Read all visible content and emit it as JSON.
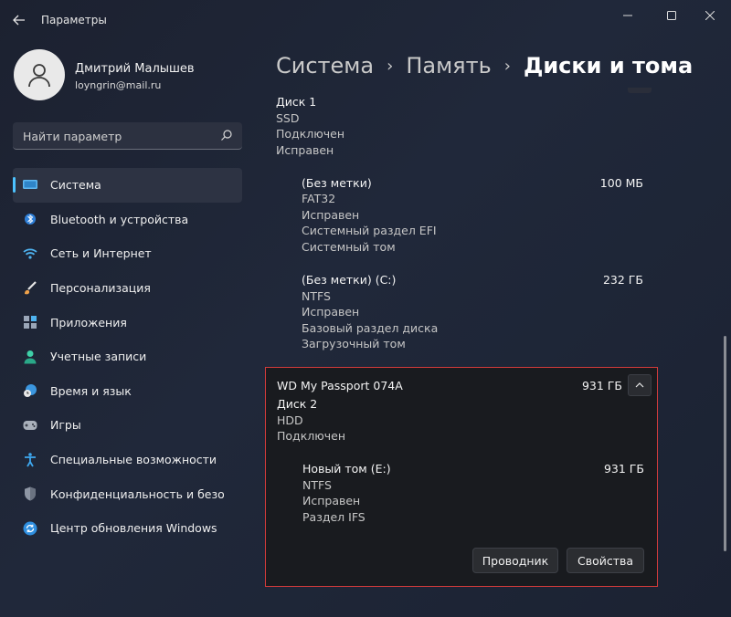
{
  "app": {
    "title": "Параметры"
  },
  "profile": {
    "name": "Дмитрий Малышев",
    "email": "loyngrin@mail.ru"
  },
  "search": {
    "placeholder": "Найти параметр"
  },
  "nav": {
    "items": [
      {
        "label": "Система",
        "icon": "display-icon",
        "active": true
      },
      {
        "label": "Bluetooth и устройства",
        "icon": "bluetooth-icon"
      },
      {
        "label": "Сеть и Интернет",
        "icon": "wifi-icon"
      },
      {
        "label": "Персонализация",
        "icon": "brush-icon"
      },
      {
        "label": "Приложения",
        "icon": "apps-icon"
      },
      {
        "label": "Учетные записи",
        "icon": "person-icon"
      },
      {
        "label": "Время и язык",
        "icon": "globe-clock-icon"
      },
      {
        "label": "Игры",
        "icon": "gamepad-icon"
      },
      {
        "label": "Специальные возможности",
        "icon": "accessibility-icon"
      },
      {
        "label": "Конфиденциальность и безопасность",
        "icon": "shield-icon"
      },
      {
        "label": "Центр обновления Windows",
        "icon": "update-icon"
      }
    ]
  },
  "breadcrumb": {
    "level1": "Система",
    "level2": "Память",
    "current": "Диски и тома"
  },
  "disk1": {
    "name": "Диск 1",
    "type": "SSD",
    "status": "Подключен",
    "health": "Исправен",
    "volumes": [
      {
        "label": "(Без метки)",
        "size": "100 МБ",
        "fs": "FAT32",
        "health": "Исправен",
        "details": [
          "Системный раздел EFI",
          "Системный том"
        ]
      },
      {
        "label": "(Без метки) (C:)",
        "size": "232 ГБ",
        "fs": "NTFS",
        "health": "Исправен",
        "details": [
          "Базовый раздел диска",
          "Загрузочный том"
        ]
      }
    ]
  },
  "disk2": {
    "model": "WD My Passport 074A",
    "total_size": "931 ГБ",
    "name": "Диск 2",
    "type": "HDD",
    "status": "Подключен",
    "volume": {
      "label": "Новый том (E:)",
      "size": "931 ГБ",
      "fs": "NTFS",
      "health": "Исправен",
      "detail": "Раздел IFS"
    },
    "buttons": {
      "explorer": "Проводник",
      "properties": "Свойства"
    }
  },
  "colors": {
    "accent": "#4cc2ff",
    "highlight_border": "#d33b3b"
  }
}
